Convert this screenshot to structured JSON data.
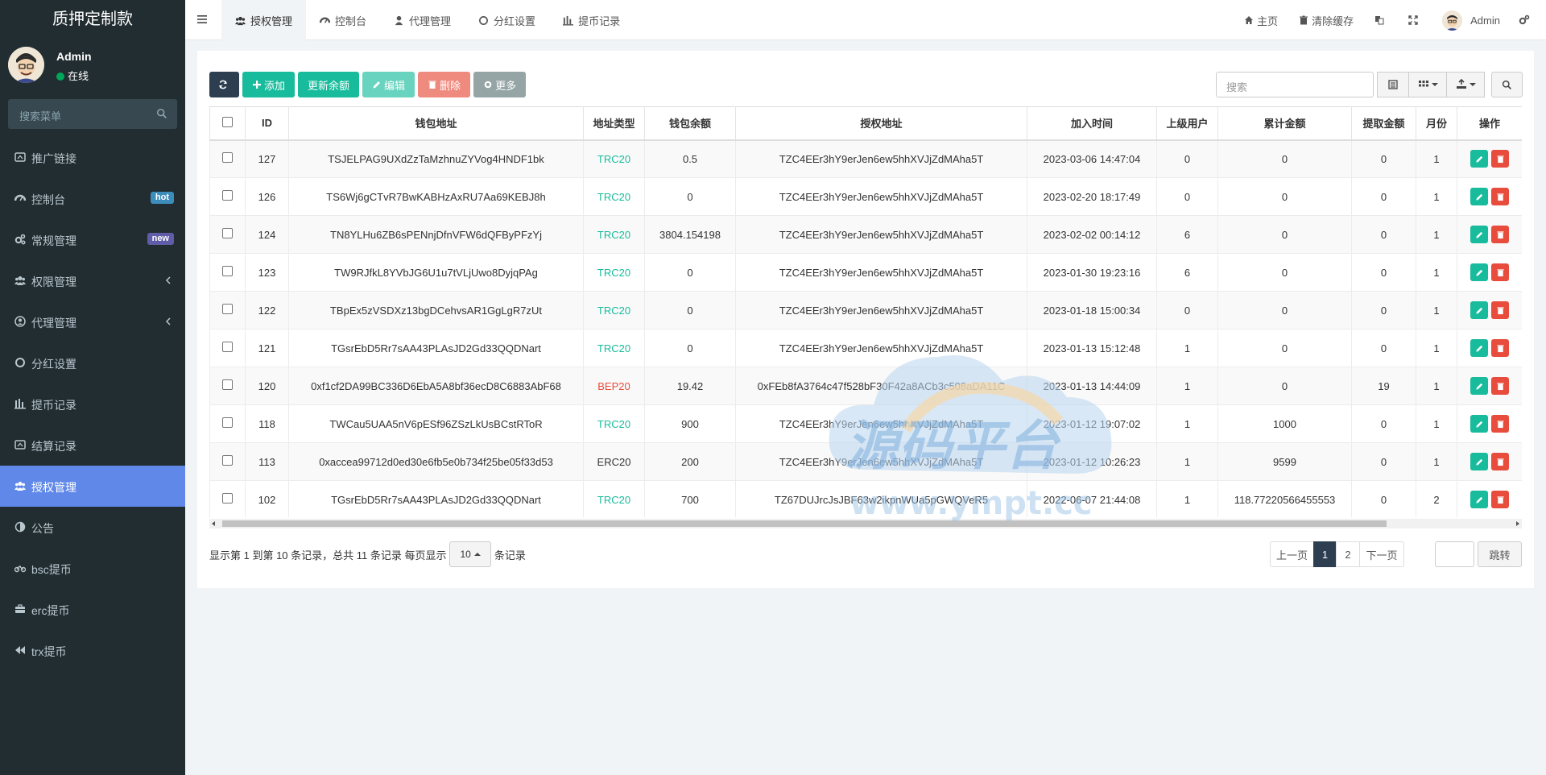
{
  "app": {
    "title": "质押定制款"
  },
  "user": {
    "name": "Admin",
    "status": "在线"
  },
  "sidebar": {
    "search_placeholder": "搜索菜单",
    "items": [
      {
        "label": "推广链接",
        "icon": "dashboard-icon"
      },
      {
        "label": "控制台",
        "icon": "dashboard-icon",
        "badge": "hot"
      },
      {
        "label": "常规管理",
        "icon": "cogs-icon",
        "badge": "new"
      },
      {
        "label": "权限管理",
        "icon": "group-icon"
      },
      {
        "label": "代理管理",
        "icon": "user-circle-icon"
      },
      {
        "label": "分红设置",
        "icon": "circle-icon"
      },
      {
        "label": "提币记录",
        "icon": "bars-icon"
      },
      {
        "label": "结算记录",
        "icon": "dashboard-icon"
      },
      {
        "label": "授权管理",
        "icon": "group-icon"
      },
      {
        "label": "公告",
        "icon": "adjust-icon"
      },
      {
        "label": "bsc提币",
        "icon": "bicycle-icon"
      },
      {
        "label": "erc提币",
        "icon": "briefcase-icon"
      },
      {
        "label": "trx提币",
        "icon": "backward-icon"
      }
    ]
  },
  "tabs": [
    {
      "label": "授权管理"
    },
    {
      "label": "控制台"
    },
    {
      "label": "代理管理"
    },
    {
      "label": "分红设置"
    },
    {
      "label": "提币记录"
    }
  ],
  "topright": {
    "home": "主页",
    "clear_cache": "清除缓存",
    "user": "Admin"
  },
  "toolbar": {
    "add": "添加",
    "update_balance": "更新余额",
    "edit": "编辑",
    "delete": "删除",
    "more": "更多",
    "search_placeholder": "搜索"
  },
  "table": {
    "columns": [
      "ID",
      "钱包地址",
      "地址类型",
      "钱包余额",
      "授权地址",
      "加入时间",
      "上级用户",
      "累计金额",
      "提取金额",
      "月份",
      "操作"
    ],
    "rows": [
      [
        "127",
        "TSJELPAG9UXdZzTaMzhnuZYVog4HNDF1bk",
        "TRC20",
        "0.5",
        "TZC4EEr3hY9erJen6ew5hhXVJjZdMAha5T",
        "2023-03-06 14:47:04",
        "0",
        "0",
        "0",
        "1"
      ],
      [
        "126",
        "TS6Wj6gCTvR7BwKABHzAxRU7Aa69KEBJ8h",
        "TRC20",
        "0",
        "TZC4EEr3hY9erJen6ew5hhXVJjZdMAha5T",
        "2023-02-20 18:17:49",
        "0",
        "0",
        "0",
        "1"
      ],
      [
        "124",
        "TN8YLHu6ZB6sPENnjDfnVFW6dQFByPFzYj",
        "TRC20",
        "3804.154198",
        "TZC4EEr3hY9erJen6ew5hhXVJjZdMAha5T",
        "2023-02-02 00:14:12",
        "6",
        "0",
        "0",
        "1"
      ],
      [
        "123",
        "TW9RJfkL8YVbJG6U1u7tVLjUwo8DyjqPAg",
        "TRC20",
        "0",
        "TZC4EEr3hY9erJen6ew5hhXVJjZdMAha5T",
        "2023-01-30 19:23:16",
        "6",
        "0",
        "0",
        "1"
      ],
      [
        "122",
        "TBpEx5zVSDXz13bgDCehvsAR1GgLgR7zUt",
        "TRC20",
        "0",
        "TZC4EEr3hY9erJen6ew5hhXVJjZdMAha5T",
        "2023-01-18 15:00:34",
        "0",
        "0",
        "0",
        "1"
      ],
      [
        "121",
        "TGsrEbD5Rr7sAA43PLAsJD2Gd33QQDNart",
        "TRC20",
        "0",
        "TZC4EEr3hY9erJen6ew5hhXVJjZdMAha5T",
        "2023-01-13 15:12:48",
        "1",
        "0",
        "0",
        "1"
      ],
      [
        "120",
        "0xf1cf2DA99BC336D6EbA5A8bf36ecD8C6883AbF68",
        "BEP20",
        "19.42",
        "0xFEb8fA3764c47f528bF30F42a8ACb3c508aDA11C",
        "2023-01-13 14:44:09",
        "1",
        "0",
        "19",
        "1"
      ],
      [
        "118",
        "TWCau5UAA5nV6pESf96ZSzLkUsBCstRToR",
        "TRC20",
        "900",
        "TZC4EEr3hY9erJen6ew5hhXVJjZdMAha5T",
        "2023-01-12 19:07:02",
        "1",
        "1000",
        "0",
        "1"
      ],
      [
        "113",
        "0xaccea99712d0ed30e6fb5e0b734f25be05f33d53",
        "ERC20",
        "200",
        "TZC4EEr3hY9erJen6ew5hhXVJjZdMAha5T",
        "2023-01-12 10:26:23",
        "1",
        "9599",
        "0",
        "1"
      ],
      [
        "102",
        "TGsrEbD5Rr7sAA43PLAsJD2Gd33QQDNart",
        "TRC20",
        "700",
        "TZ67DUJrcJsJBF63w2ikpnWUa5pGWQVeR5",
        "2022-06-07 21:44:08",
        "1",
        "118.77220566455553",
        "0",
        "2"
      ]
    ]
  },
  "footer": {
    "info_prefix": "显示第 1 到第 10 条记录，总共 11 条记录 每页显示",
    "page_size": "10",
    "info_suffix": "条记录",
    "prev": "上一页",
    "pages": [
      "1",
      "2"
    ],
    "next": "下一页",
    "go": "跳转"
  },
  "watermark": {
    "title": "源码平台",
    "url": "www.ympt.cc"
  },
  "colors": {
    "sidebar_bg": "#222d32",
    "active_menu": "#6088e8",
    "success": "#18bc9c",
    "danger": "#e74c3c",
    "primary_dark": "#2c3e50"
  }
}
